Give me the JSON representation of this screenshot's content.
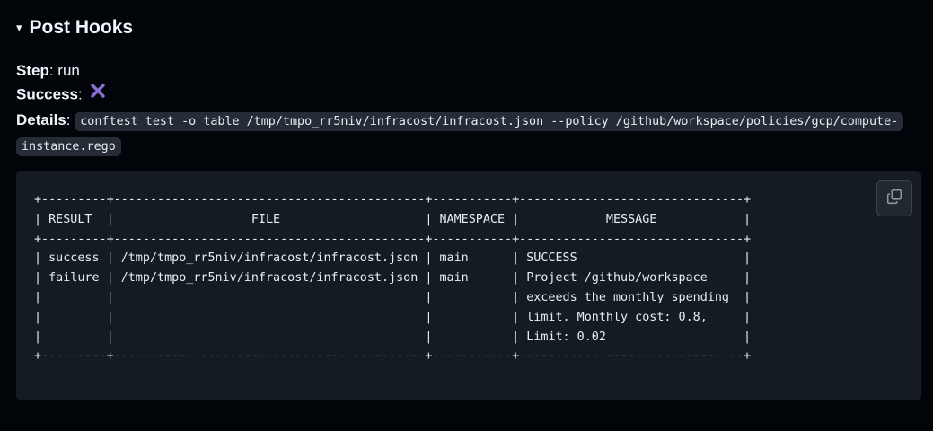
{
  "section": {
    "caret": "▾",
    "title": "Post Hooks"
  },
  "step": {
    "label": "Step",
    "value": "run"
  },
  "success": {
    "label": "Success",
    "icon": "x-mark-icon",
    "icon_color": "#8b6fd6"
  },
  "details": {
    "label": "Details",
    "command": "conftest test -o table /tmp/tmpo_rr5niv/infracost/infracost.json --policy /github/workspace/policies/gcp/compute-instance.rego"
  },
  "output": {
    "table_text": "+---------+-------------------------------------------+-----------+-------------------------------+\n| RESULT  |                   FILE                    | NAMESPACE |            MESSAGE            |\n+---------+-------------------------------------------+-----------+-------------------------------+\n| success | /tmp/tmpo_rr5niv/infracost/infracost.json | main      | SUCCESS                       |\n| failure | /tmp/tmpo_rr5niv/infracost/infracost.json | main      | Project /github/workspace     |\n|         |                                           |           | exceeds the monthly spending  |\n|         |                                           |           | limit. Monthly cost: 0.8,     |\n|         |                                           |           | Limit: 0.02                   |\n+---------+-------------------------------------------+-----------+-------------------------------+",
    "copy_icon": "copy-icon"
  },
  "colors": {
    "page_bg": "#010409",
    "code_bg": "#151b23",
    "inline_code_bg": "#262c36",
    "text": "#f0f6fc"
  }
}
